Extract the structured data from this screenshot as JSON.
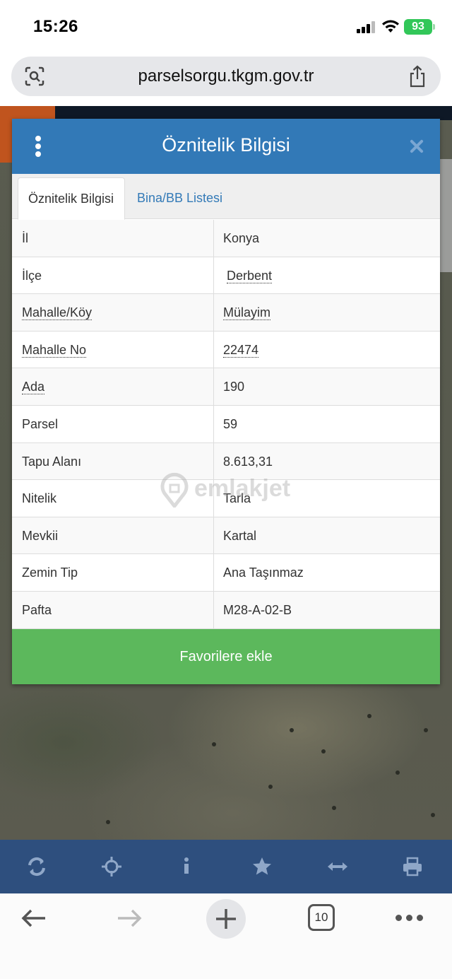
{
  "status_bar": {
    "time": "15:26",
    "battery": "93"
  },
  "browser": {
    "url": "parselsorgu.tkgm.gov.tr",
    "tab_count": "10"
  },
  "panel": {
    "title": "Öznitelik Bilgisi",
    "tabs": [
      {
        "label": "Öznitelik Bilgisi",
        "active": true
      },
      {
        "label": "Bina/BB Listesi",
        "active": false
      }
    ],
    "rows": [
      {
        "key": "İl",
        "value": "Konya"
      },
      {
        "key": "İlçe",
        "value": "Derbent"
      },
      {
        "key": "Mahalle/Köy",
        "value": "Mülayim"
      },
      {
        "key": "Mahalle No",
        "value": "22474"
      },
      {
        "key": "Ada",
        "value": "190"
      },
      {
        "key": "Parsel",
        "value": "59"
      },
      {
        "key": "Tapu Alanı",
        "value": "8.613,31"
      },
      {
        "key": "Nitelik",
        "value": "Tarla"
      },
      {
        "key": "Mevkii",
        "value": "Kartal"
      },
      {
        "key": "Zemin Tip",
        "value": "Ana Taşınmaz"
      },
      {
        "key": "Pafta",
        "value": "M28-A-02-B"
      }
    ],
    "favorite_button": "Favorilere ekle"
  },
  "watermark": "emlakjet",
  "colors": {
    "header": "#3279b7",
    "favorite": "#5cb85c",
    "toolbar": "#2e4f7e",
    "battery": "#32c759"
  },
  "toolbar_icons": [
    "refresh-icon",
    "crosshair-icon",
    "info-icon",
    "star-icon",
    "measure-icon",
    "print-icon"
  ]
}
